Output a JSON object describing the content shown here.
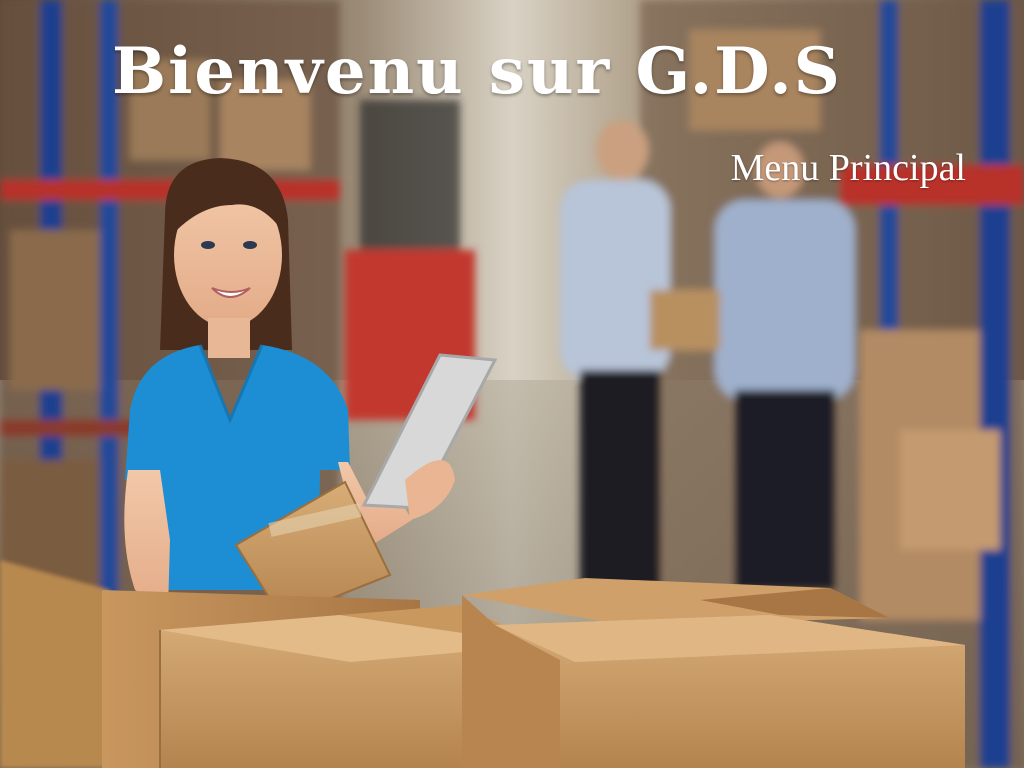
{
  "header": {
    "title": "Bienvenu sur G.D.S",
    "subtitle": "Menu Principal"
  },
  "background": {
    "description_icon": "warehouse-photo"
  },
  "colors": {
    "title_text": "#ffffff",
    "shirt_blue": "#1e8ed4",
    "cardboard": "#c89a64",
    "rack_blue": "#1f3f8f",
    "rack_red": "#b8322a"
  }
}
